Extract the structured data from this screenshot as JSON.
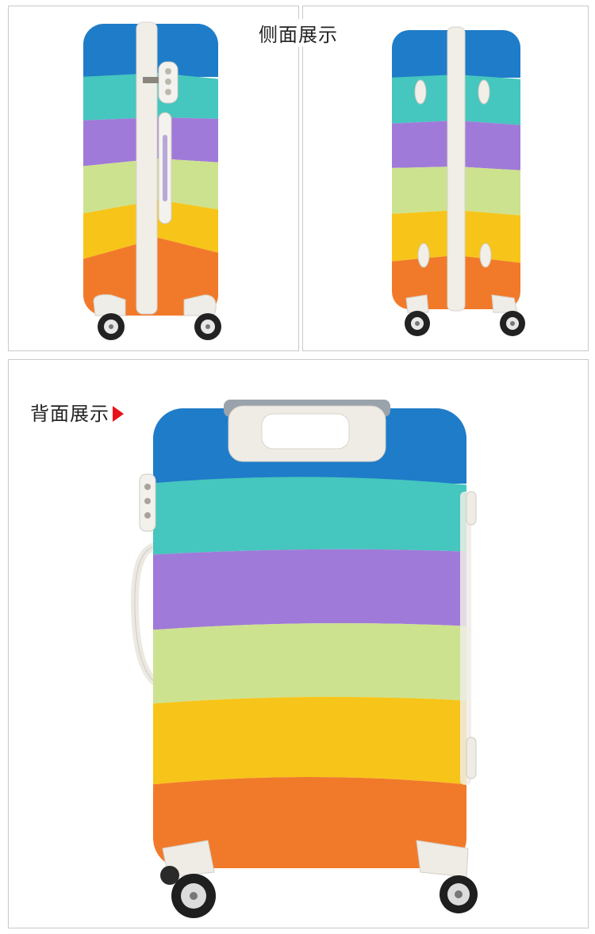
{
  "labels": {
    "side": "侧面展示",
    "back": "背面展示"
  },
  "colors": {
    "blue": "#1f7cc8",
    "teal": "#45c6be",
    "purple": "#a07ad8",
    "lime": "#cde28e",
    "yellow": "#f7c41a",
    "orange": "#f17a2a",
    "frame": "#e9e6e0",
    "arrow": "#e8121c",
    "panel_border": "#c9c9c9"
  },
  "icons": {
    "side_arrow": "play-triangle-icon",
    "lock": "combination-lock-icon",
    "wheel": "spinner-wheel-icon"
  }
}
